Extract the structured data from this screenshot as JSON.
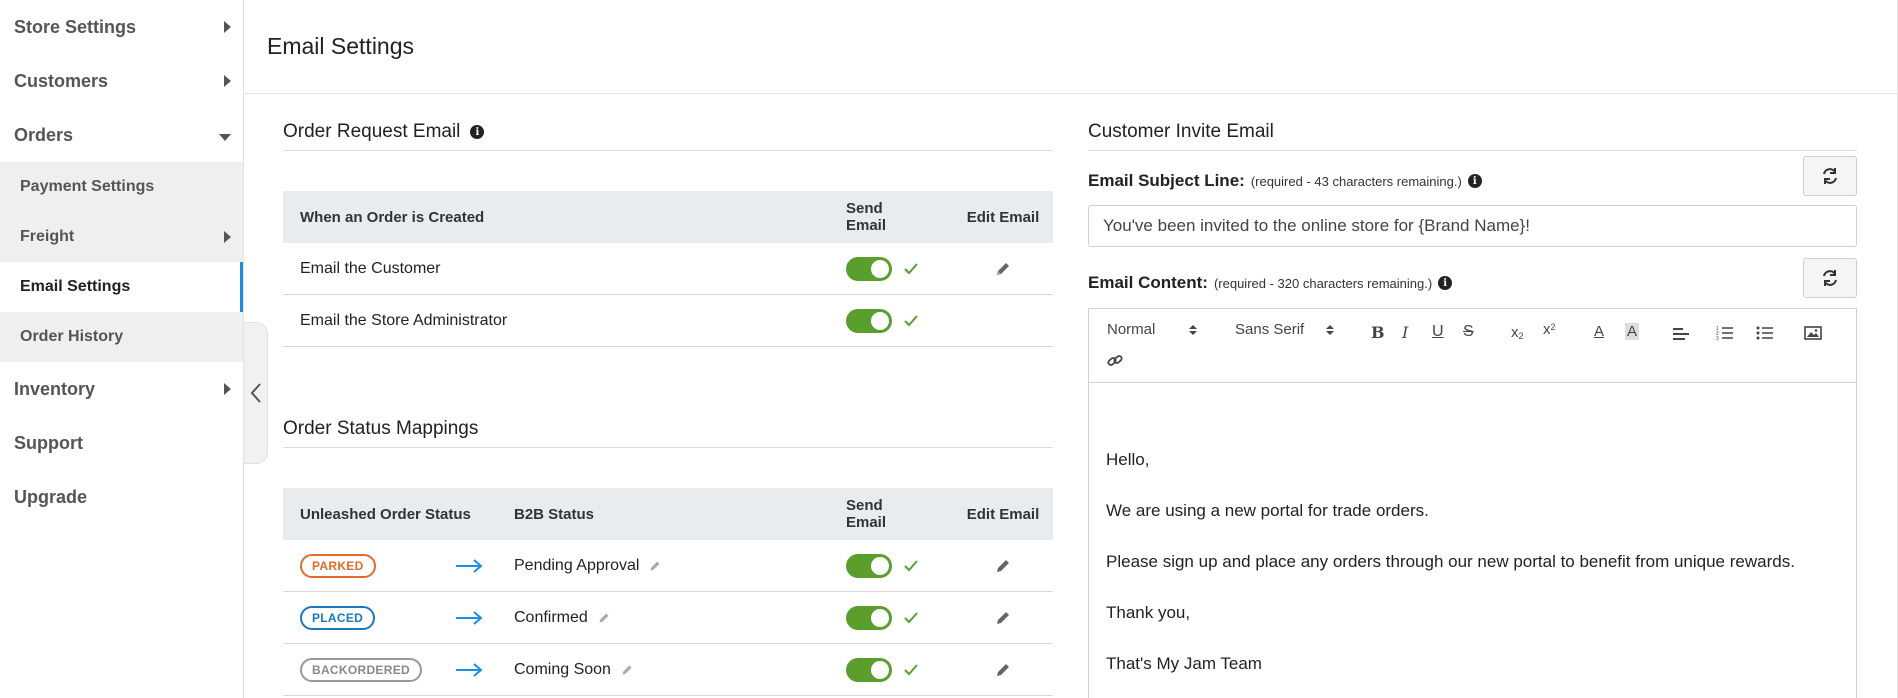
{
  "sidebar": {
    "items": [
      {
        "label": "Store Settings"
      },
      {
        "label": "Customers"
      },
      {
        "label": "Orders"
      },
      {
        "label": "Payment Settings"
      },
      {
        "label": "Freight"
      },
      {
        "label": "Email Settings"
      },
      {
        "label": "Order History"
      },
      {
        "label": "Inventory"
      },
      {
        "label": "Support"
      },
      {
        "label": "Upgrade"
      }
    ],
    "active_color": "#1b8fe0"
  },
  "header": {
    "title": "Email Settings"
  },
  "order_request": {
    "title": "Order Request Email",
    "columns": [
      "When an Order is Created",
      "Send Email",
      "Edit Email"
    ],
    "rows": [
      {
        "label": "Email the Customer",
        "send": true,
        "editable": true
      },
      {
        "label": "Email the Store Administrator",
        "send": true,
        "editable": false
      }
    ]
  },
  "status_mappings": {
    "title": "Order Status Mappings",
    "columns": [
      "Unleashed Order Status",
      "B2B Status",
      "Send Email",
      "Edit Email"
    ],
    "rows": [
      {
        "status": "PARKED",
        "b2b": "Pending Approval",
        "send": true
      },
      {
        "status": "PLACED",
        "b2b": "Confirmed",
        "send": true
      },
      {
        "status": "BACKORDERED",
        "b2b": "Coming Soon",
        "send": true
      }
    ]
  },
  "invite": {
    "title": "Customer Invite Email",
    "subject_label": "Email Subject Line:",
    "subject_hint": "(required - 43 characters remaining.)",
    "subject_value": "You've been invited to the online store for {Brand Name}!",
    "content_label": "Email Content:",
    "content_hint": "(required - 320 characters remaining.)",
    "toolbar": {
      "format": "Normal",
      "font": "Sans Serif"
    },
    "body": [
      "Hello,",
      "We are using a new portal for trade orders.",
      "Please sign up and place any orders through our new portal to benefit from unique rewards.",
      "Thank you,",
      "That's My Jam Team"
    ]
  },
  "colors": {
    "toggle_on": "#5a9e2e",
    "arrow": "#1b8fe0",
    "parked": "#e36b2c",
    "placed": "#1a78c2",
    "backordered": "#888888"
  }
}
